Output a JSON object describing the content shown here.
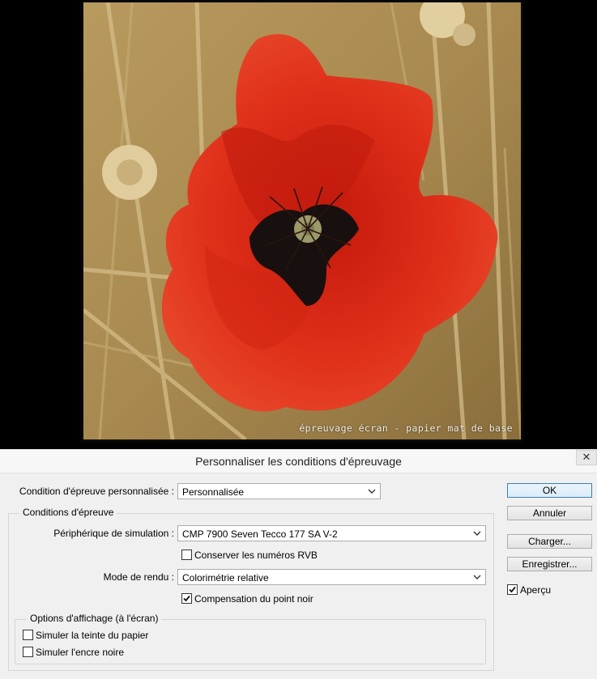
{
  "photo": {
    "caption": "épreuvage écran - papier mat de base"
  },
  "dialog": {
    "title": "Personnaliser les conditions d'épreuvage",
    "close_glyph": "✕",
    "custom_condition": {
      "label": "Condition d'épreuve personnalisée :",
      "value": "Personnalisée"
    },
    "conditions_group": {
      "title": "Conditions d'épreuve",
      "device": {
        "label": "Périphérique de simulation :",
        "value": "CMP 7900 Seven Tecco 177 SA V-2"
      },
      "preserve_rgb": {
        "label": "Conserver les numéros RVB",
        "checked": false
      },
      "intent": {
        "label": "Mode de rendu :",
        "value": "Colorimétrie relative"
      },
      "black_point": {
        "label": "Compensation du point noir",
        "checked": true
      }
    },
    "display_group": {
      "title": "Options d'affichage (à l'écran)",
      "paper_color": {
        "label": "Simuler la teinte du papier",
        "checked": false
      },
      "black_ink": {
        "label": "Simuler l'encre noire",
        "checked": false
      }
    },
    "buttons": {
      "ok": "OK",
      "cancel": "Annuler",
      "load": "Charger...",
      "save": "Enregistrer..."
    },
    "preview": {
      "label": "Aperçu",
      "checked": true
    }
  }
}
